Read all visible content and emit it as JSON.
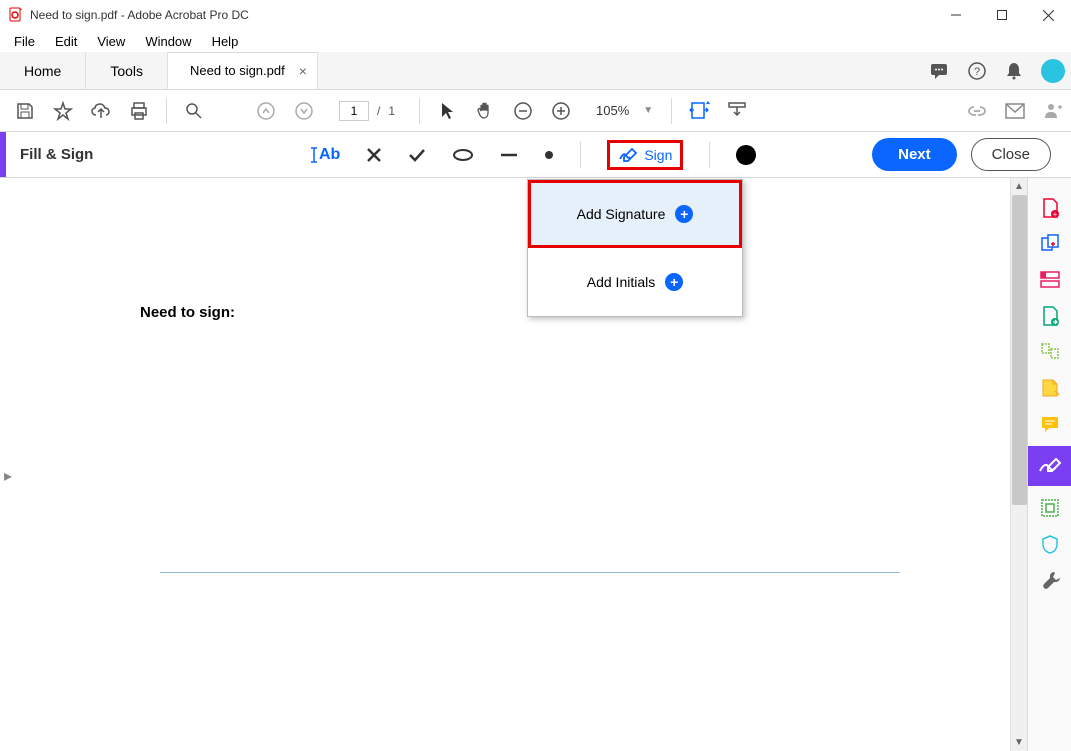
{
  "window": {
    "title": "Need to sign.pdf - Adobe Acrobat Pro DC"
  },
  "menu": {
    "file": "File",
    "edit": "Edit",
    "view": "View",
    "window": "Window",
    "help": "Help"
  },
  "tabs": {
    "home": "Home",
    "tools": "Tools",
    "document": "Need to sign.pdf"
  },
  "toolbar": {
    "page_current": "1",
    "page_sep": "/",
    "page_total": "1",
    "zoom": "105%"
  },
  "fillsign": {
    "title": "Fill & Sign",
    "text_tool": "Ab",
    "sign_label": "Sign",
    "next_label": "Next",
    "close_label": "Close"
  },
  "sign_menu": {
    "add_signature": "Add Signature",
    "add_initials": "Add Initials"
  },
  "document": {
    "body_text": "Need to sign:"
  }
}
